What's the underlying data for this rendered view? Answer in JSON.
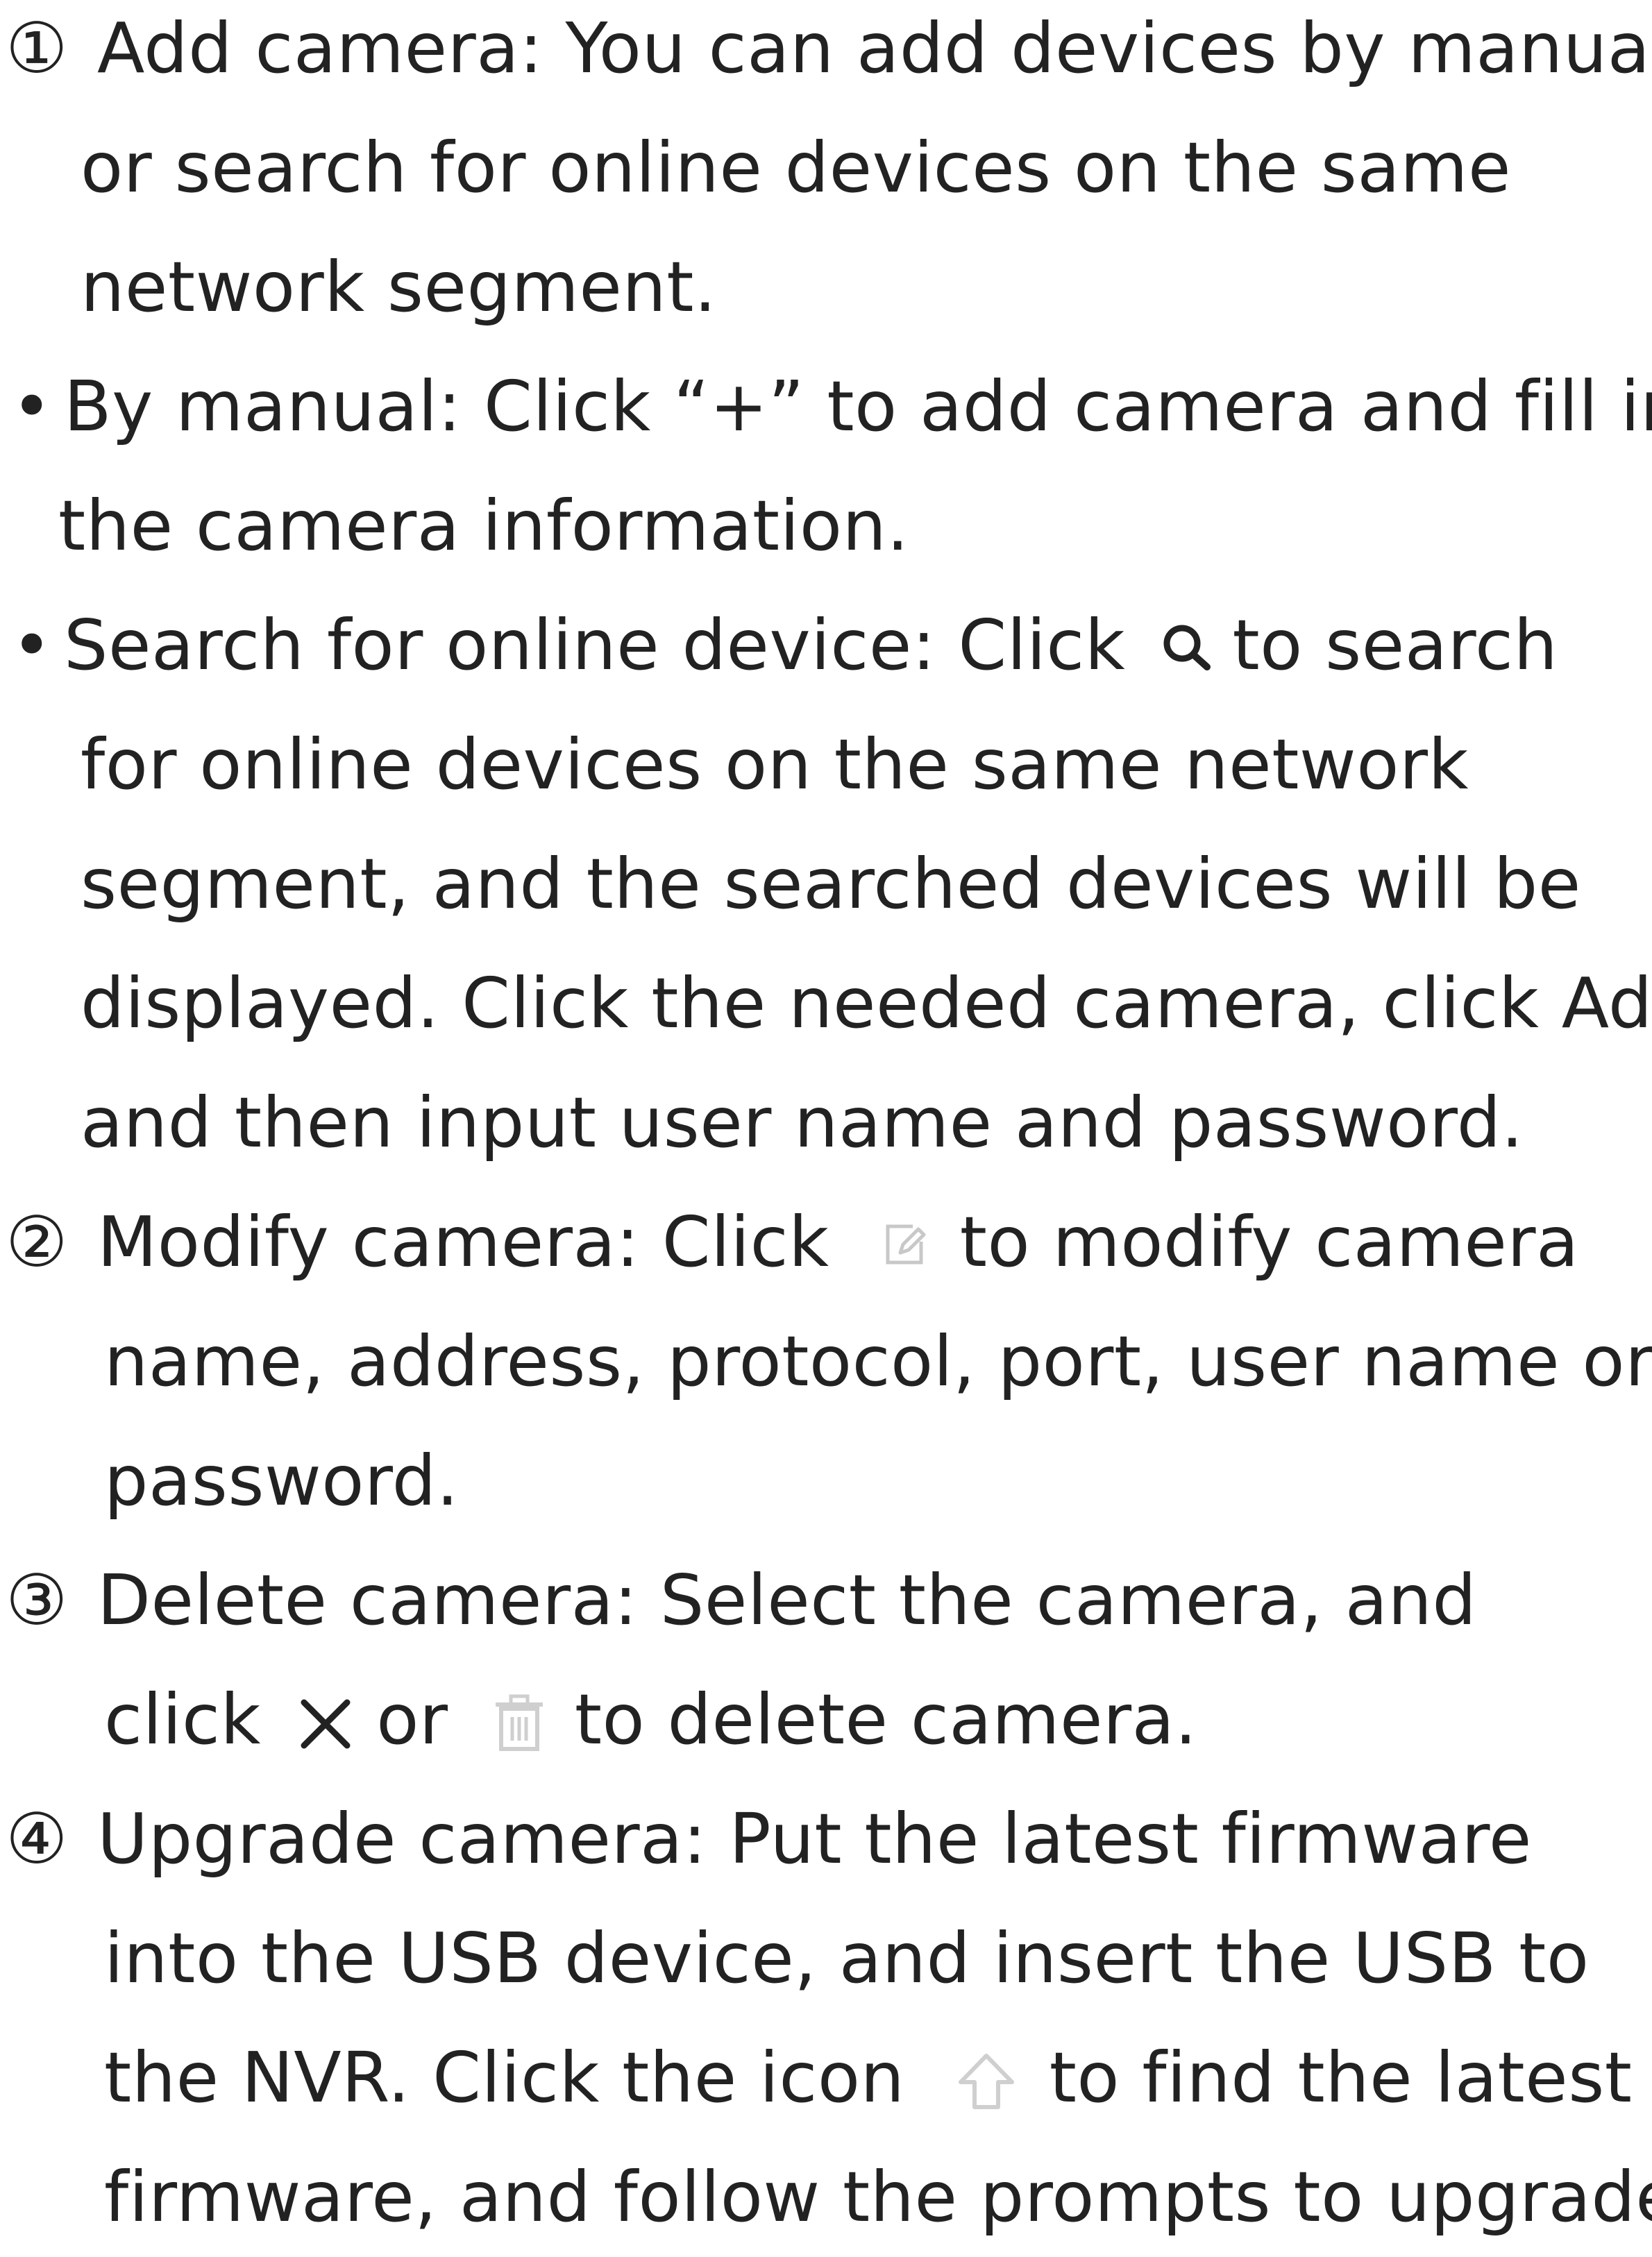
{
  "items": [
    {
      "marker": "①",
      "lines": [
        "Add camera: You can add devices by manual,",
        "or search for online devices on the same",
        "network segment."
      ]
    },
    {
      "marker": "•",
      "lines": [
        "By manual: Click “+” to add camera and fill in",
        "the camera information."
      ]
    },
    {
      "marker": "•",
      "search_line_before": "Search for online device: Click",
      "search_line_after": "to search",
      "lines": [
        "for online devices on the same network",
        "segment, and the searched devices will be",
        "displayed. Click the needed camera, click Add,",
        "and then input user name and password."
      ]
    },
    {
      "marker": "②",
      "first_before": "Modify camera: Click",
      "first_after": "to modify camera",
      "lines": [
        "name, address, protocol, port, user name or",
        "password."
      ]
    },
    {
      "marker": "③",
      "first": "Delete camera: Select the camera, and",
      "second_before": "click",
      "second_mid": "or",
      "second_after": "to delete camera."
    },
    {
      "marker": "④",
      "lines": [
        "Upgrade camera: Put the latest firmware",
        "into the USB device, and insert the USB to"
      ],
      "third_before": "the NVR. Click the icon",
      "third_after": "to find the latest",
      "last": "firmware, and follow the prompts to upgrade."
    }
  ],
  "icons": {
    "search": "search-icon",
    "edit": "edit-icon",
    "close": "close-icon",
    "trash": "trash-icon",
    "upload": "upload-arrow-icon"
  }
}
